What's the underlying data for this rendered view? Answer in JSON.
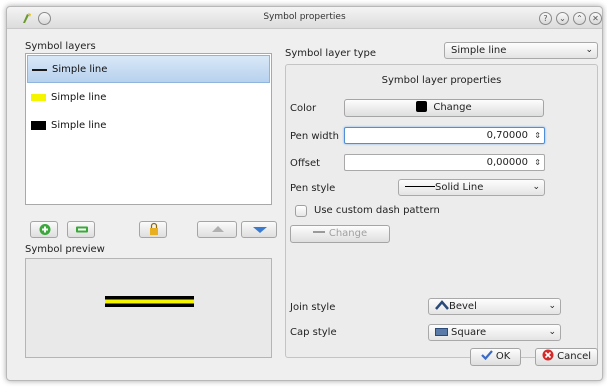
{
  "window": {
    "title": "Symbol properties"
  },
  "titlebar": {
    "help_glyph": "?",
    "minimize_glyph": "⌄",
    "maximize_glyph": "⌃",
    "close_glyph": "✕"
  },
  "left": {
    "layers_heading": "Symbol layers",
    "layers": [
      {
        "label": "Simple line",
        "swatch_color": "#1a1a1a",
        "swatch_kind": "line",
        "selected": true
      },
      {
        "label": "Simple line",
        "swatch_color": "#f5f500",
        "swatch_kind": "block",
        "selected": false
      },
      {
        "label": "Simple line",
        "swatch_color": "#000000",
        "swatch_kind": "block",
        "selected": false
      }
    ],
    "preview_heading": "Symbol preview"
  },
  "right": {
    "layer_type_label": "Symbol layer type",
    "layer_type_value": "Simple line",
    "properties_heading": "Symbol layer properties",
    "color_label": "Color",
    "color_button": "Change",
    "pen_width_label": "Pen width",
    "pen_width_value": "0,70000",
    "offset_label": "Offset",
    "offset_value": "0,00000",
    "pen_style_label": "Pen style",
    "pen_style_value": "Solid Line",
    "custom_dash_label": "Use custom dash pattern",
    "dash_change_button": "Change",
    "join_style_label": "Join style",
    "join_style_value": "Bevel",
    "cap_style_label": "Cap style",
    "cap_style_value": "Square"
  },
  "footer": {
    "ok_label": "OK",
    "cancel_label": "Cancel"
  },
  "icons": {
    "chevron": "⌄",
    "spin": "⇕"
  }
}
